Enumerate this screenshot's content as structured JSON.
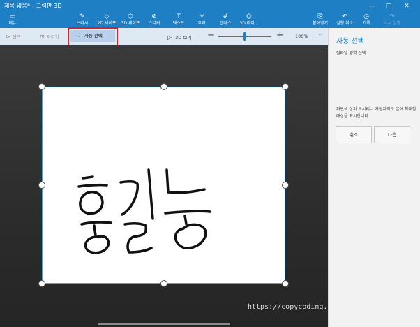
{
  "window": {
    "title": "제목 없음* - 그림판 3D",
    "minimize": "—",
    "maximize": "□",
    "close": "✕"
  },
  "ribbon": {
    "menu": {
      "label": "메뉴",
      "icon": "folder-icon"
    },
    "items": [
      {
        "label": "브러시",
        "icon": "brush-icon"
      },
      {
        "label": "2D 셰이프",
        "icon": "2d-shapes-icon"
      },
      {
        "label": "3D 셰이프",
        "icon": "3d-shapes-icon"
      },
      {
        "label": "스티커",
        "icon": "sticker-icon"
      },
      {
        "label": "텍스트",
        "icon": "text-icon"
      },
      {
        "label": "효과",
        "icon": "effects-icon"
      },
      {
        "label": "캔버스",
        "icon": "canvas-icon"
      },
      {
        "label": "3D 라이...",
        "icon": "3d-library-icon"
      }
    ],
    "right": [
      {
        "label": "붙여넣기",
        "icon": "paste-icon"
      },
      {
        "label": "실행 취소",
        "icon": "undo-icon"
      },
      {
        "label": "기록",
        "icon": "history-icon"
      },
      {
        "label": "다시 실행",
        "icon": "redo-icon"
      }
    ]
  },
  "toolbar": {
    "select": "선택",
    "crop": "자르기",
    "magic_select": "자동 선택",
    "view_3d": "3D 보기",
    "zoom_level": "100%",
    "zoom_fraction": 0.5,
    "more": "···"
  },
  "canvas": {
    "drawing_text": "홍길동"
  },
  "panel": {
    "title": "자동 선택",
    "subtitle": "잘라낼 영역 선택",
    "description": "파란색 상자 모서리나 가장자리로 끌어 확대할 대상을 표시합니다.",
    "cancel_label": "취소",
    "next_label": "다음"
  },
  "watermark": "https://copycoding.tistory.com/",
  "colors": {
    "accent": "#1e7fc4",
    "highlight_box": "#e02020",
    "workspace": "#2b2b2b"
  }
}
